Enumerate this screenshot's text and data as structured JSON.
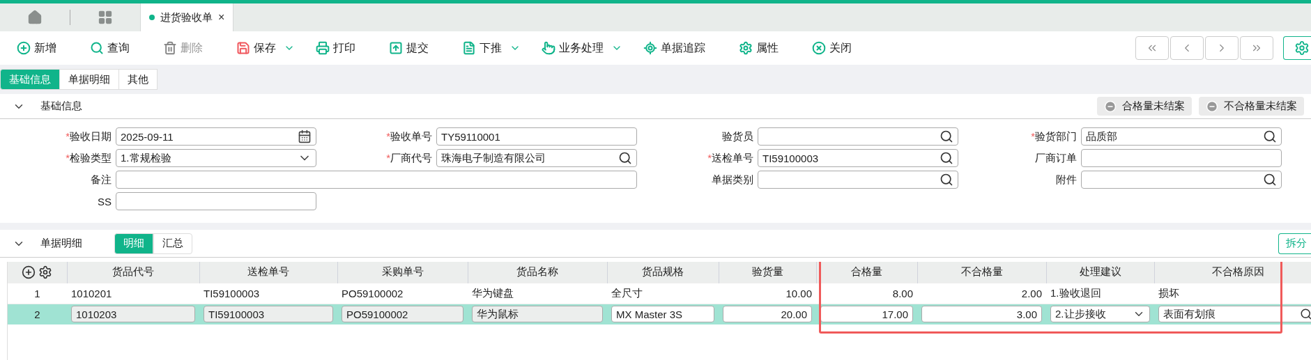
{
  "tabs": [
    {
      "kind": "home",
      "selected": false
    },
    {
      "kind": "apps",
      "selected": false
    },
    {
      "kind": "document",
      "label": "进货验收单",
      "close": "×",
      "selected": true
    }
  ],
  "toolbar": [
    {
      "label": "新增",
      "dropdown": false,
      "disabled": false
    },
    {
      "label": "查询",
      "dropdown": false,
      "disabled": false
    },
    {
      "label": "删除",
      "dropdown": false,
      "disabled": true
    },
    {
      "label": "保存",
      "dropdown": true,
      "disabled": false
    },
    {
      "label": "打印",
      "dropdown": false,
      "disabled": false
    },
    {
      "label": "提交",
      "dropdown": false,
      "disabled": false
    },
    {
      "label": "下推",
      "dropdown": true,
      "disabled": false
    },
    {
      "label": "业务处理",
      "dropdown": true,
      "disabled": false
    },
    {
      "label": "单据追踪",
      "dropdown": false,
      "disabled": false
    },
    {
      "label": "属性",
      "dropdown": false,
      "disabled": false
    },
    {
      "label": "关闭",
      "dropdown": false,
      "disabled": false
    }
  ],
  "sub_tabs": [
    {
      "label": "基础信息",
      "selected": true
    },
    {
      "label": "单据明细",
      "selected": false
    },
    {
      "label": "其他",
      "selected": false
    }
  ],
  "basic_section": {
    "title": "基础信息",
    "expanded": true,
    "badges": [
      "合格量未结案",
      "不合格量未结案"
    ],
    "fields": [
      {
        "marker": "*",
        "label": "验收日期",
        "kind": "date",
        "value": "2025-09-11",
        "span": false
      },
      {
        "marker": "*",
        "label": "验收单号",
        "kind": "text",
        "value": "TY59110001",
        "span": false
      },
      {
        "label": "验货员",
        "kind": "lookup",
        "span": false
      },
      {
        "marker": "*",
        "label": "验货部门",
        "kind": "lookup",
        "value": "品质部",
        "span": false
      },
      {
        "marker": "*",
        "label": "检验类型",
        "kind": "select",
        "value": "1.常规检验",
        "span": false
      },
      {
        "marker": "*",
        "label": "厂商代号",
        "kind": "lookup",
        "value": "珠海电子制造有限公司",
        "span": false
      },
      {
        "marker": "*",
        "label": "送检单号",
        "kind": "lookup",
        "value": "TI59100003",
        "span": false
      },
      {
        "label": "厂商订单",
        "kind": "text",
        "span": false
      },
      {
        "label": "备注",
        "kind": "text",
        "span": true
      },
      {
        "label": "单据类别",
        "kind": "lookup",
        "span": false
      },
      {
        "label": "附件",
        "kind": "lookup",
        "span": false
      },
      {
        "label": "SS",
        "kind": "text",
        "span": false
      }
    ]
  },
  "detail_section": {
    "title": "单据明细",
    "expanded": true,
    "views": [
      {
        "label": "明细",
        "selected": true
      },
      {
        "label": "汇总",
        "selected": false
      }
    ],
    "split_button": "拆分",
    "table": {
      "columns": [
        {
          "label": "货品代号",
          "kind": "readonly",
          "highlighted": false
        },
        {
          "label": "送检单号",
          "kind": "readonly",
          "highlighted": false
        },
        {
          "label": "采购单号",
          "kind": "readonly",
          "highlighted": false
        },
        {
          "label": "货品名称",
          "kind": "readonly",
          "highlighted": false
        },
        {
          "label": "货品规格",
          "kind": "text",
          "highlighted": false
        },
        {
          "label": "验货量",
          "kind": "number",
          "highlighted": false
        },
        {
          "label": "合格量",
          "kind": "number",
          "highlighted": true
        },
        {
          "label": "不合格量",
          "kind": "number",
          "highlighted": true
        },
        {
          "label": "处理建议",
          "kind": "select",
          "highlighted": true
        },
        {
          "label": "不合格原因",
          "kind": "lookup",
          "highlighted": true
        }
      ],
      "rows": [
        {
          "number": "1",
          "selected": false,
          "cells": [
            "1010201",
            "TI59100003",
            "PO59100002",
            "华为键盘",
            "全尺寸",
            "10.00",
            "8.00",
            "2.00",
            "1.验收退回",
            "损坏"
          ]
        },
        {
          "number": "2",
          "selected": true,
          "cells": [
            "1010203",
            "TI59100003",
            "PO59100002",
            "华为鼠标",
            "MX Master 3S",
            "20.00",
            "17.00",
            "3.00",
            "2.让步接收",
            "表面有划痕"
          ]
        }
      ]
    }
  }
}
